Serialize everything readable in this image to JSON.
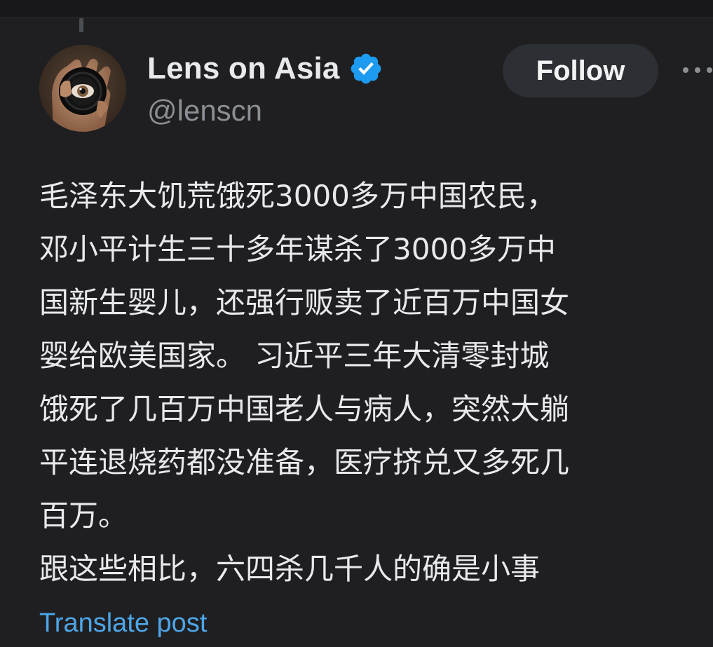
{
  "post": {
    "author": {
      "display_name": "Lens on Asia",
      "handle": "@lenscn",
      "verified": true,
      "avatar_icon": "camera-lens-eye-avatar"
    },
    "follow_label": "Follow",
    "more_icon": "more-options-icon",
    "body_lines": [
      "毛泽东大饥荒饿死3000多万中国农民，",
      "邓小平计生三十多年谋杀了3000多万中",
      "国新生婴儿，还强行贩卖了近百万中国女",
      "婴给欧美国家。 习近平三年大清零封城",
      "饿死了几百万中国老人与病人，突然大躺",
      "平连退烧药都没准备，医疗挤兑又多死几",
      "百万。",
      "跟这些相比，六四杀几千人的确是小事"
    ],
    "translate_label": "Translate post"
  },
  "colors": {
    "background": "#1f1f21",
    "text": "#e7e9ea",
    "handle": "#8b8f94",
    "link": "#4da6e8",
    "verified": "#1d9bf0",
    "follow_bg": "#2c2f33"
  }
}
